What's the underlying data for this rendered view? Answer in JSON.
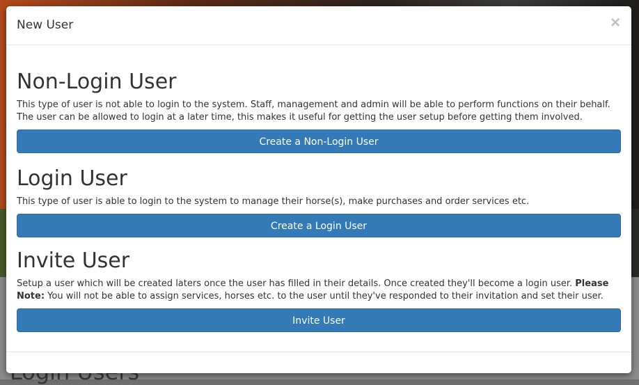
{
  "backdrop": {
    "bottom_text": "Login Users"
  },
  "modal": {
    "title": "New User",
    "close_label": "×",
    "sections": [
      {
        "heading": "Non-Login User",
        "description": "This type of user is not able to login to the system. Staff, management and admin will be able to perform functions on their behalf. The user can be allowed to login at a later time, this makes it useful for getting the user setup before getting them involved.",
        "button": "Create a Non-Login User"
      },
      {
        "heading": "Login User",
        "description": "This type of user is able to login to the system to manage their horse(s), make purchases and order services etc.",
        "button": "Create a Login User"
      },
      {
        "heading": "Invite User",
        "description_pre": "Setup a user which will be created laters once the user has filled in their details. Once created they'll become a login user. ",
        "description_bold": "Please Note:",
        "description_post": " You will not be able to assign services, horses etc. to the user until they've responded to their invitation and set their user.",
        "button": "Invite User"
      }
    ]
  },
  "colors": {
    "primary_button": "#337ab7",
    "primary_button_border": "#2e6da4",
    "text": "#333333"
  }
}
